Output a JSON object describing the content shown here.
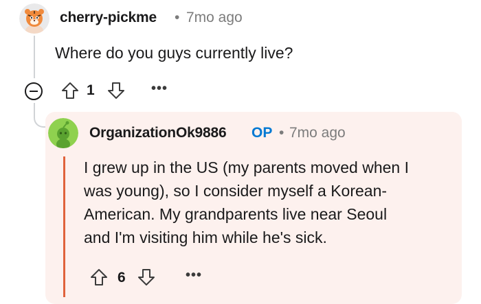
{
  "parent_comment": {
    "avatar_icon": "snoo-avatar-icon",
    "author": "cherry-pickme",
    "separator": "•",
    "time": "7mo ago",
    "body": "Where do you guys currently live?",
    "votes": "1",
    "more": "•••"
  },
  "reply": {
    "avatar_icon": "snoo-avatar-icon",
    "author": "OrganizationOk9886",
    "op_badge": "OP",
    "separator": "•",
    "time": "7mo ago",
    "body_lines": [
      "I grew up in the US (my parents moved when I",
      "was young), so I consider myself a Korean-",
      "American. My grandparents live near Seoul",
      "and I'm visiting him while he's sick."
    ],
    "votes": "6",
    "more": "•••"
  },
  "colors": {
    "reply_background": "#fdf1ee",
    "accent_bar": "#e0623c",
    "op_badge": "#0079d3",
    "muted_text": "#7c7c7c"
  }
}
